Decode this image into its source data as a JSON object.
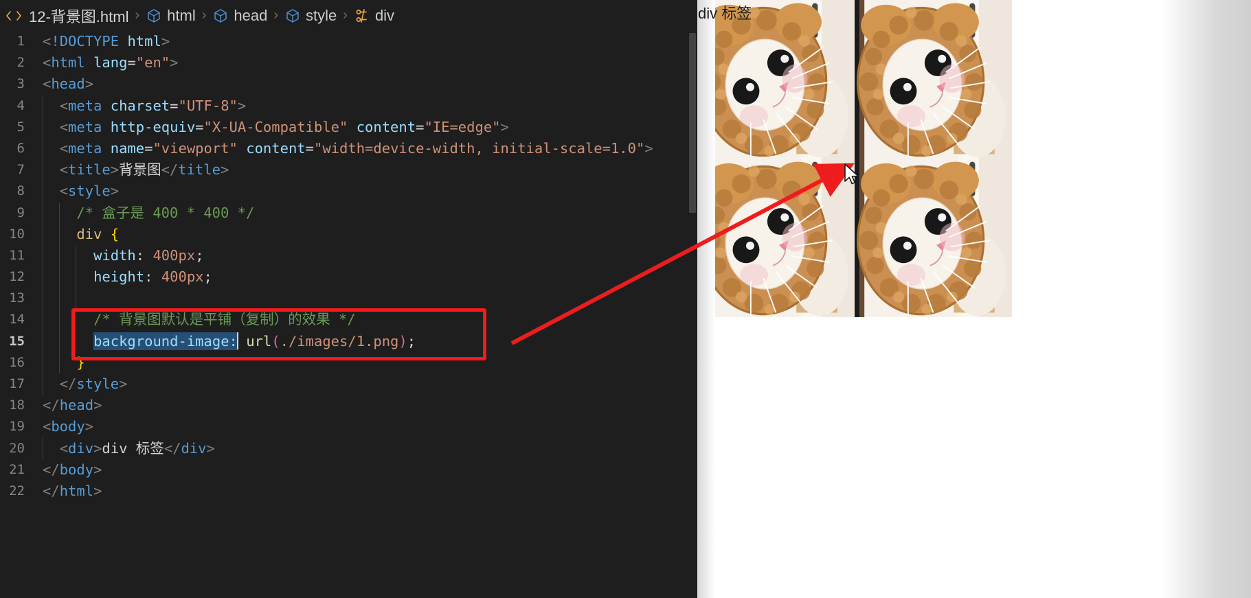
{
  "window": {
    "title": "12-背景图.html"
  },
  "breadcrumb": {
    "file_icon": "code-brackets-icon",
    "file": "12-背景图.html",
    "separator": "›",
    "items": [
      {
        "icon": "cube-icon",
        "label": "html"
      },
      {
        "icon": "cube-icon",
        "label": "head"
      },
      {
        "icon": "cube-icon",
        "label": "style"
      },
      {
        "icon": "css-rule-icon",
        "label": "div"
      }
    ]
  },
  "editor": {
    "current_line": 15,
    "selection_text": "background-image:",
    "lines": [
      {
        "n": "1",
        "text": "<!DOCTYPE html>"
      },
      {
        "n": "2",
        "text": "<html lang=\"en\">"
      },
      {
        "n": "3",
        "text": "<head>"
      },
      {
        "n": "4",
        "text": "  <meta charset=\"UTF-8\">"
      },
      {
        "n": "5",
        "text": "  <meta http-equiv=\"X-UA-Compatible\" content=\"IE=edge\">"
      },
      {
        "n": "6",
        "text": "  <meta name=\"viewport\" content=\"width=device-width, initial-scale=1.0\">"
      },
      {
        "n": "7",
        "text": "  <title>背景图</title>"
      },
      {
        "n": "8",
        "text": "  <style>"
      },
      {
        "n": "9",
        "text": "    /* 盒子是 400 * 400 */"
      },
      {
        "n": "10",
        "text": "    div {"
      },
      {
        "n": "11",
        "text": "      width: 400px;"
      },
      {
        "n": "12",
        "text": "      height: 400px;"
      },
      {
        "n": "13",
        "text": ""
      },
      {
        "n": "14",
        "text": "      /* 背景图默认是平铺（复制）的效果 */"
      },
      {
        "n": "15",
        "text": "      background-image: url(./images/1.png);"
      },
      {
        "n": "16",
        "text": "    }"
      },
      {
        "n": "17",
        "text": "  </style>"
      },
      {
        "n": "18",
        "text": "</head>"
      },
      {
        "n": "19",
        "text": "<body>"
      },
      {
        "n": "20",
        "text": "  <div>div 标签</div>"
      },
      {
        "n": "21",
        "text": "</body>"
      },
      {
        "n": "22",
        "text": "</html>"
      }
    ],
    "tokens": {
      "doctype": "<!DOCTYPE html>",
      "l2_tag": "html",
      "l2_attr": "lang",
      "l2_val": "\"en\"",
      "l3_tag": "head",
      "l4_tag": "meta",
      "l4_attr": "charset",
      "l4_val": "\"UTF-8\"",
      "l5_tag": "meta",
      "l5_attr1": "http-equiv",
      "l5_val1": "\"X-UA-Compatible\"",
      "l5_attr2": "content",
      "l5_val2": "\"IE=edge\"",
      "l6_tag": "meta",
      "l6_attr1": "name",
      "l6_val1": "\"viewport\"",
      "l6_attr2": "content",
      "l6_val2": "\"width=device-width, initial-scale=1.0\"",
      "l7_tag": "title",
      "l7_text": "背景图",
      "l8_tag": "style",
      "l9_comment": "/* 盒子是 400 * 400 */",
      "l10_sel": "div",
      "l10_brace": "{",
      "l11_prop": "width:",
      "l11_val": "400px;",
      "l12_prop": "height:",
      "l12_val": "400px;",
      "l14_comment": "/* 背景图默认是平铺（复制）的效果 */",
      "l15_prop": "background-image:",
      "l15_fn": "url",
      "l15_open": "(",
      "l15_path": "./images/1.png",
      "l15_close": ")",
      "l15_semi": ";",
      "l16_brace": "}",
      "l17_tag": "style",
      "l18_tag": "head",
      "l19_tag": "body",
      "l20_tag": "div",
      "l20_text": "div 标签",
      "l21_tag": "body",
      "l22_tag": "html"
    }
  },
  "preview": {
    "div_label": "div 标签",
    "box_size": "400 * 400",
    "background_image": "./images/1.png",
    "tile_count": 4,
    "image_alt": "cat-wearing-fluffy-lion-hat"
  },
  "annotations": {
    "highlight_box_color": "#f41b1b",
    "arrow_color": "#ee1c1c",
    "arrow_from": "background-image declaration",
    "arrow_to": "tiled background preview"
  },
  "colors": {
    "editor_bg": "#1e1e1e",
    "selection": "#264f78",
    "tag": "#569cd6",
    "attr": "#9cdcfe",
    "string": "#ce9178",
    "comment": "#6a9955",
    "brace": "#ffd700",
    "number": "#b5cea8",
    "function": "#dcdcaa",
    "paren": "#d16d9e",
    "accent_red": "#f41b1b"
  }
}
